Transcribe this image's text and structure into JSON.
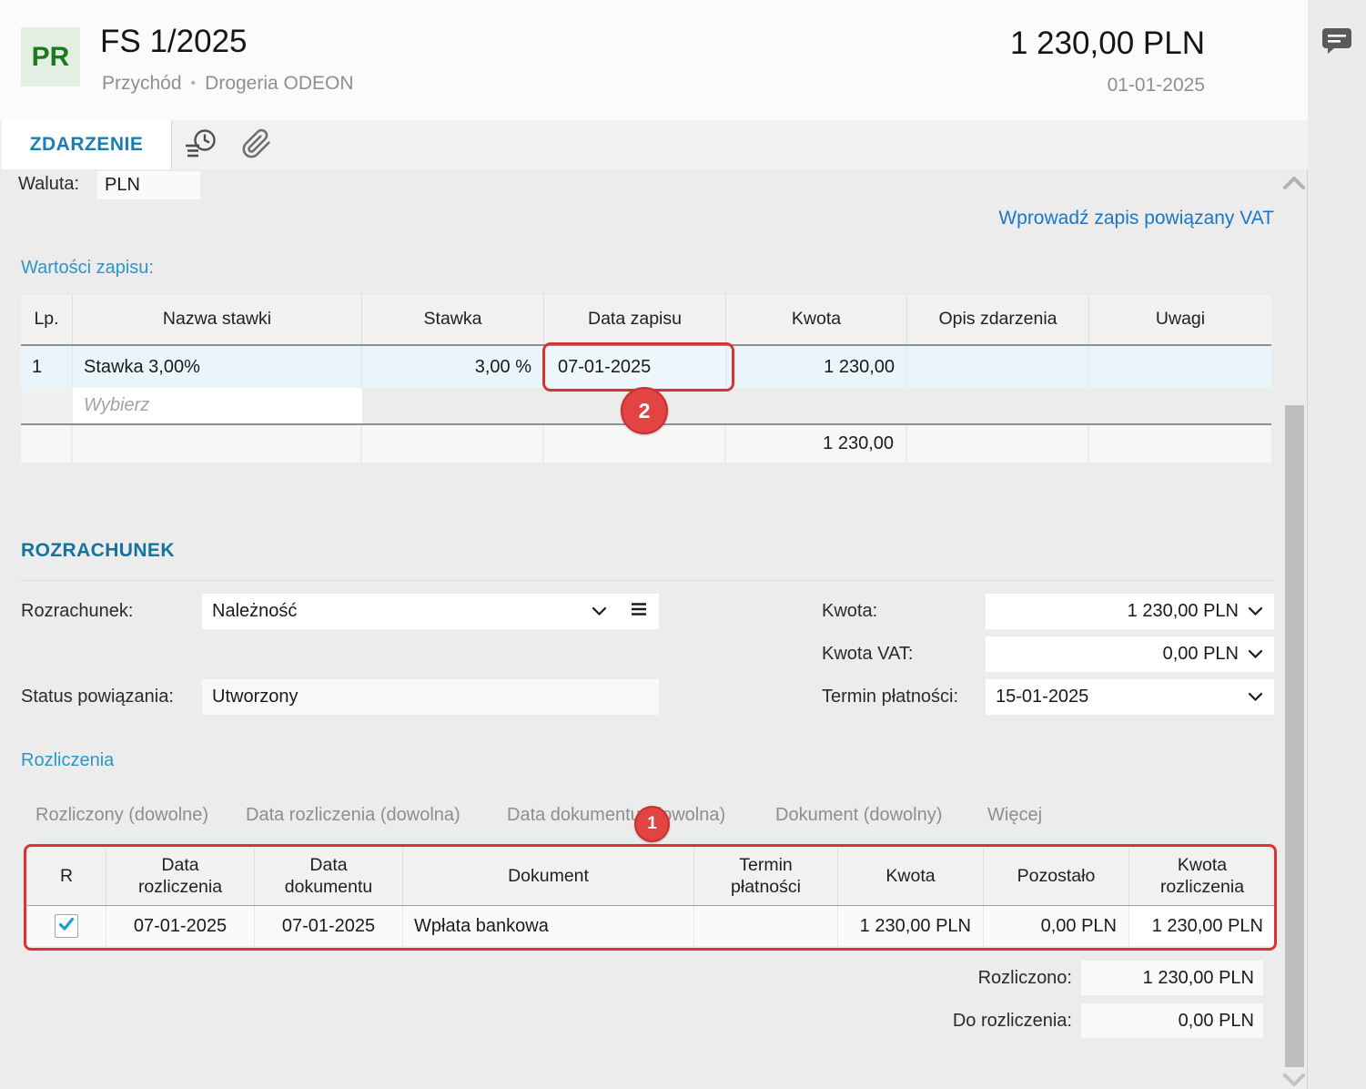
{
  "header": {
    "badge": "PR",
    "title": "FS 1/2025",
    "doc_type": "Przychód",
    "separator": "•",
    "company": "Drogeria ODEON",
    "amount": "1 230,00 PLN",
    "date": "01-01-2025"
  },
  "tabs": {
    "active": "ZDARZENIE"
  },
  "currency": {
    "label": "Waluta:",
    "value": "PLN"
  },
  "vat_link": "Wprowadź zapis powiązany VAT",
  "wartosci_zapisu": {
    "title": "Wartości zapisu:",
    "columns": [
      "Lp.",
      "Nazwa stawki",
      "Stawka",
      "Data zapisu",
      "Kwota",
      "Opis zdarzenia",
      "Uwagi"
    ],
    "row": {
      "lp": "1",
      "nazwa": "Stawka 3,00%",
      "stawka": "3,00 %",
      "data_zapisu": "07-01-2025",
      "kwota": "1 230,00",
      "opis": "",
      "uwagi": ""
    },
    "placeholder": "Wybierz",
    "total_kwota": "1 230,00",
    "annotation_badge": "2"
  },
  "rozrachunek": {
    "title": "ROZRACHUNEK",
    "rozrachunek_label": "Rozrachunek:",
    "rozrachunek_value": "Należność",
    "status_label": "Status powiązania:",
    "status_value": "Utworzony",
    "kwota_label": "Kwota:",
    "kwota_value": "1 230,00 PLN",
    "kwota_vat_label": "Kwota VAT:",
    "kwota_vat_value": "0,00 PLN",
    "termin_label": "Termin płatności:",
    "termin_value": "15-01-2025"
  },
  "rozliczenia": {
    "title": "Rozliczenia",
    "filters": [
      "Rozliczony (dowolne)",
      "Data rozliczenia (dowolna)",
      "Data dokumentu (dowolna)",
      "Dokument (dowolny)",
      "Więcej"
    ],
    "annotation_badge": "1",
    "columns": [
      "R",
      "Data rozliczenia",
      "Data dokumentu",
      "Dokument",
      "Termin płatności",
      "Kwota",
      "Pozostało",
      "Kwota rozliczenia"
    ],
    "row": {
      "checked": true,
      "data_rozliczenia": "07-01-2025",
      "data_dokumentu": "07-01-2025",
      "dokument": "Wpłata bankowa",
      "termin_platnosci": "",
      "kwota": "1 230,00 PLN",
      "pozostalo": "0,00 PLN",
      "kwota_rozliczenia": "1 230,00 PLN"
    },
    "rozliczono_label": "Rozliczono:",
    "rozliczono_value": "1 230,00 PLN",
    "do_rozliczenia_label": "Do rozliczenia:",
    "do_rozliczenia_value": "0,00 PLN"
  },
  "colors": {
    "accent_blue": "#1b7db3",
    "section_teal": "#2a96c8",
    "link_blue": "#1976c8",
    "annotation_red": "#e03131",
    "badge_green_text": "#1e7a1e",
    "badge_green_bg": "#e4efe4",
    "row_highlight": "#e9f5fa"
  },
  "icons": {
    "comment": "speech-bubble",
    "history": "clock-with-lines",
    "attachment": "paperclip",
    "collapse": "chevron-up",
    "scroll_down": "chevron-down",
    "dropdown": "chevron-down",
    "menu": "hamburger",
    "checked": "checkmark"
  }
}
